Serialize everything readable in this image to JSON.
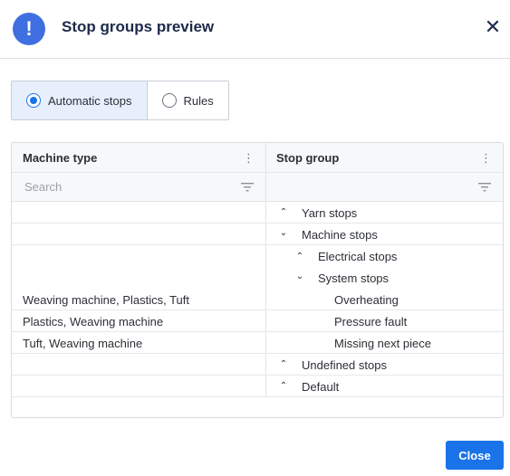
{
  "dialog": {
    "title": "Stop groups preview",
    "header_icon": "exclamation-icon",
    "close_icon": "close-icon"
  },
  "toggle": {
    "options": [
      {
        "label": "Automatic stops",
        "selected": true
      },
      {
        "label": "Rules",
        "selected": false
      }
    ]
  },
  "grid": {
    "columns": [
      {
        "label": "Machine type",
        "menu_icon": "kebab-menu-icon"
      },
      {
        "label": "Stop group",
        "menu_icon": "kebab-menu-icon"
      }
    ],
    "search_placeholder": "Search",
    "filter_icon": "filter-icon",
    "rows": [
      {
        "machine_type": "",
        "stop_group": "Yarn stops",
        "level": 0,
        "expander": "collapsed"
      },
      {
        "machine_type": "",
        "stop_group": "Machine stops",
        "level": 0,
        "expander": "expanded"
      },
      {
        "machine_type": "",
        "stop_group": "Electrical stops",
        "level": 1,
        "expander": "collapsed"
      },
      {
        "machine_type": "",
        "stop_group": "System stops",
        "level": 1,
        "expander": "expanded"
      },
      {
        "machine_type": "Weaving machine, Plastics, Tuft",
        "stop_group": "Overheating",
        "level": 2,
        "expander": "none"
      },
      {
        "machine_type": "Plastics, Weaving machine",
        "stop_group": "Pressure fault",
        "level": 2,
        "expander": "none"
      },
      {
        "machine_type": "Tuft, Weaving machine",
        "stop_group": "Missing next piece",
        "level": 2,
        "expander": "none"
      },
      {
        "machine_type": "",
        "stop_group": "Undefined stops",
        "level": 0,
        "expander": "collapsed"
      },
      {
        "machine_type": "",
        "stop_group": "Default",
        "level": 0,
        "expander": "collapsed"
      }
    ]
  },
  "footer": {
    "close_label": "Close"
  },
  "colors": {
    "accent": "#1a73e8",
    "header_icon_bg": "#3f6fe0",
    "title": "#1c2a4a",
    "selected_toggle_bg": "#e7effc"
  }
}
